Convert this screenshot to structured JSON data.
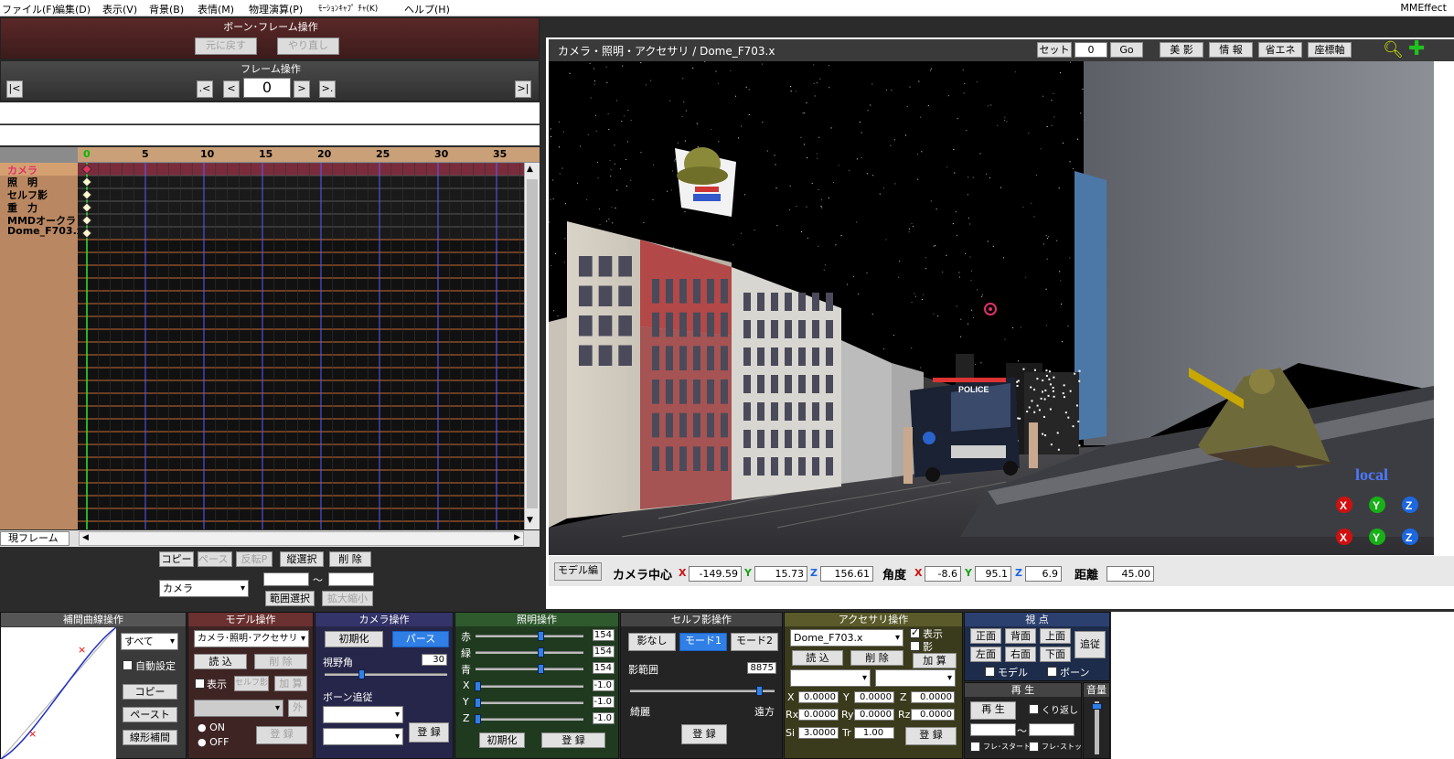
{
  "menu": {
    "items": [
      "ファイル(F)",
      "編集(D)",
      "表示(V)",
      "背景(B)",
      "表情(M)",
      "物理演算(P)",
      "ﾓｰｼｮﾝｷｬﾌﾟ ﾁｬ(K)",
      "ヘルプ(H)"
    ],
    "app_name": "MMEffect"
  },
  "bone_panel": {
    "title": "ボーン･フレーム操作",
    "undo": "元に戻す",
    "redo": "やり直し"
  },
  "frame_panel": {
    "title": "フレーム操作",
    "first": "|<",
    "prev_key": ".<",
    "prev": "<",
    "frame": "0",
    "next": ">",
    "next_key": ">.",
    "last": ">|"
  },
  "timeline": {
    "ticks": [
      "0",
      "5",
      "10",
      "15",
      "20",
      "25",
      "30",
      "35"
    ],
    "rows": [
      "カメラ",
      "照　明",
      "セルフ影",
      "重　力",
      "MMDオークラ",
      "Dome_F703.x"
    ],
    "current_frame_label": "現フレーム"
  },
  "edit_buttons": {
    "copy": "コピー",
    "paste": "ペースト",
    "flip_paste": "反転P",
    "vertical_select": "縦選択",
    "delete": "削 除",
    "target": "カメラ",
    "tilde": "〜",
    "range_select": "範囲選択",
    "scale": "拡大縮小"
  },
  "viewport": {
    "title": "カメラ・照明・アクセサリ / Dome_F703.x",
    "set_label": "セット",
    "set_value": "0",
    "go": "Go",
    "toggles": [
      "美 影",
      "情 報",
      "省エネ",
      "座標軸"
    ],
    "local_label": "local",
    "police_label": "POLICE"
  },
  "camera_status": {
    "mode_button": "モデル編",
    "center_label": "カメラ中心",
    "x": "-149.59",
    "y": "15.73",
    "z": "156.61",
    "angle_label": "角度",
    "ax": "-8.6",
    "ay": "95.1",
    "az": "6.9",
    "dist_label": "距離",
    "dist": "45.00",
    "axis_x": "X",
    "axis_y": "Y",
    "axis_z": "Z"
  },
  "interp_panel": {
    "title": "補間曲線操作",
    "select": "すべて",
    "auto": "自動設定",
    "copy": "コピー",
    "paste": "ペースト",
    "linear": "線形補間"
  },
  "model_panel": {
    "title": "モデル操作",
    "select": "カメラ･照明･アクセサリ",
    "load": "読 込",
    "delete": "削 除",
    "show": "表示",
    "self_shadow": "セルフ影",
    "add": "加 算",
    "outside": "外",
    "on": "ON",
    "off": "OFF",
    "register": "登 録"
  },
  "camera_panel": {
    "title": "カメラ操作",
    "init": "初期化",
    "perspective": "パース",
    "fov_label": "視野角",
    "fov": "30",
    "bone_follow": "ボーン追従",
    "register": "登 録",
    "fov_level": 0.3
  },
  "light_panel": {
    "title": "照明操作",
    "r_label": "赤",
    "g_label": "緑",
    "b_label": "青",
    "r": "154",
    "g": "154",
    "b": "154",
    "x_label": "X",
    "y_label": "Y",
    "z_label": "Z",
    "x": "-1.0",
    "y": "-1.0",
    "z": "-1.0",
    "init": "初期化",
    "register": "登 録",
    "rgb_level": 0.6,
    "xyz_level": 0.0
  },
  "shadow_panel": {
    "title": "セルフ影操作",
    "none": "影なし",
    "mode1": "モード1",
    "mode2": "モード2",
    "range_label": "影範囲",
    "range": "8875",
    "near": "綺麗",
    "far": "遠方",
    "register": "登 録",
    "range_level": 0.89
  },
  "accessory_panel": {
    "title": "アクセサリ操作",
    "select": "Dome_F703.x",
    "show": "表示",
    "shadow": "影",
    "load": "読 込",
    "delete": "削 除",
    "add": "加 算",
    "x": "0.0000",
    "y": "0.0000",
    "z": "0.0000",
    "rx": "0.0000",
    "ry": "0.0000",
    "rz": "0.0000",
    "si": "3.0000",
    "tr": "1.00",
    "register": "登 録",
    "l_x": "X",
    "l_y": "Y",
    "l_z": "Z",
    "l_rx": "Rx",
    "l_ry": "Ry",
    "l_rz": "Rz",
    "l_si": "Si",
    "l_tr": "Tr"
  },
  "view_panel": {
    "title": "視 点",
    "front": "正面",
    "back": "背面",
    "top": "上面",
    "left": "左面",
    "right": "右面",
    "bottom": "下面",
    "follow": "追従",
    "model": "モデル",
    "bone": "ボーン"
  },
  "play_panel": {
    "title": "再 生",
    "play": "再 生",
    "loop": "くり返し",
    "tilde": "〜",
    "start": "フレ･スタート",
    "stop": "フレ･ストップ"
  },
  "volume_panel": {
    "title": "音量"
  },
  "colors": {
    "bone_header": "#5a2828",
    "accent_blue": "#2f7fe6",
    "timeline_tan": "#caa078"
  }
}
